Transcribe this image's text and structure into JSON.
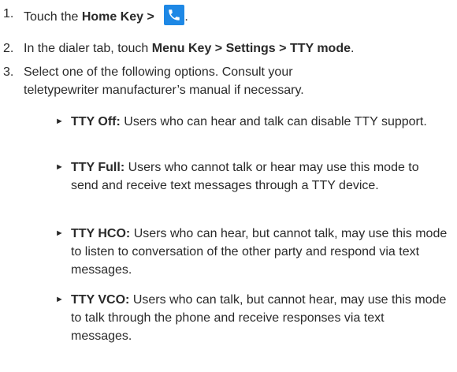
{
  "steps": [
    {
      "number": "1.",
      "prefix": "Touch the ",
      "bold": "Home Key > ",
      "icon": "phone-icon",
      "suffix": "."
    },
    {
      "number": "2.",
      "prefix": "In the dialer tab, touch ",
      "bold": "Menu Key > Settings > TTY mode",
      "suffix": "."
    },
    {
      "number": "3.",
      "line1": "Select one of the following options. Consult your",
      "line2": "teletypewriter manufacturer’s manual if necessary."
    }
  ],
  "options": [
    {
      "title": "TTY Off:",
      "desc": " Users who can hear and talk can disable TTY support."
    },
    {
      "title": "TTY Full:",
      "desc": " Users who cannot talk or hear may use this mode to send and receive text messages through a TTY device."
    },
    {
      "title": "TTY HCO:",
      "desc": " Users who can hear, but cannot talk, may use this mode to listen to conversation of the other party and respond via text messages."
    },
    {
      "title": "TTY VCO:",
      "desc": " Users who can talk, but cannot hear, may use this mode to talk through the phone and receive responses via text messages."
    }
  ],
  "colors": {
    "icon_bg": "#1e88e5",
    "text": "#2a2a2a"
  }
}
